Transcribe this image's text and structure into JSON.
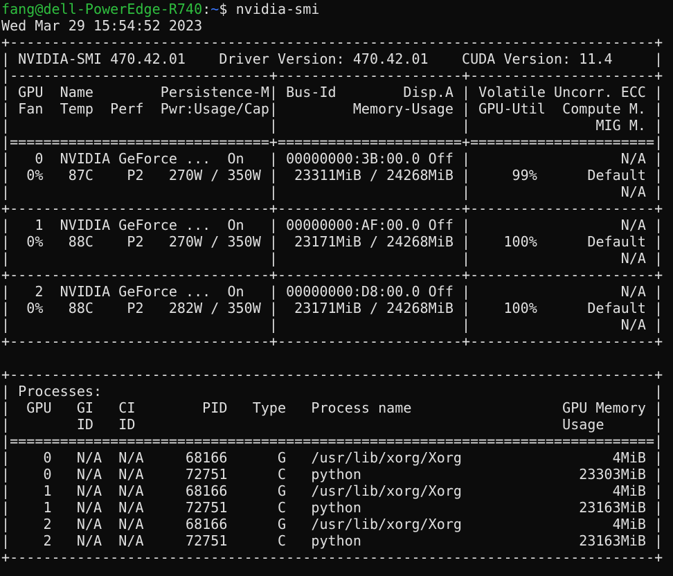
{
  "terminal": {
    "prompt": {
      "user_host": "fang@dell-PowerEdge-R740",
      "sep": ":",
      "path": "~",
      "symbol": "$ ",
      "command": "nvidia-smi"
    },
    "timestamp": "Wed Mar 29 15:54:52 2023",
    "colors": {
      "background": "#0c0c0c",
      "text": "#e0e0e0",
      "prompt_user": "#2fbf3f",
      "prompt_path": "#3b78ff"
    },
    "output_lines": [
      "+-----------------------------------------------------------------------------+",
      "| NVIDIA-SMI 470.42.01    Driver Version: 470.42.01    CUDA Version: 11.4     |",
      "|-------------------------------+----------------------+----------------------+",
      "| GPU  Name        Persistence-M| Bus-Id        Disp.A | Volatile Uncorr. ECC |",
      "| Fan  Temp  Perf  Pwr:Usage/Cap|         Memory-Usage | GPU-Util  Compute M. |",
      "|                               |                      |               MIG M. |",
      "|===============================+======================+======================|",
      "|   0  NVIDIA GeForce ...  On   | 00000000:3B:00.0 Off |                  N/A |",
      "|  0%   87C    P2   270W / 350W |  23311MiB / 24268MiB |     99%      Default |",
      "|                               |                      |                  N/A |",
      "+-------------------------------+----------------------+----------------------+",
      "|   1  NVIDIA GeForce ...  On   | 00000000:AF:00.0 Off |                  N/A |",
      "|  0%   88C    P2   270W / 350W |  23171MiB / 24268MiB |    100%      Default |",
      "|                               |                      |                  N/A |",
      "+-------------------------------+----------------------+----------------------+",
      "|   2  NVIDIA GeForce ...  On   | 00000000:D8:00.0 Off |                  N/A |",
      "|  0%   88C    P2   282W / 350W |  23171MiB / 24268MiB |    100%      Default |",
      "|                               |                      |                  N/A |",
      "+-------------------------------+----------------------+----------------------+",
      "",
      "+-----------------------------------------------------------------------------+",
      "| Processes:                                                                  |",
      "|  GPU   GI   CI        PID   Type   Process name                  GPU Memory |",
      "|        ID   ID                                                   Usage      |",
      "|=============================================================================|",
      "|    0   N/A  N/A     68166      G   /usr/lib/xorg/Xorg                  4MiB |",
      "|    0   N/A  N/A     72751      C   python                          23303MiB |",
      "|    1   N/A  N/A     68166      G   /usr/lib/xorg/Xorg                  4MiB |",
      "|    1   N/A  N/A     72751      C   python                          23163MiB |",
      "|    2   N/A  N/A     68166      G   /usr/lib/xorg/Xorg                  4MiB |",
      "|    2   N/A  N/A     72751      C   python                          23163MiB |",
      "+-----------------------------------------------------------------------------+"
    ]
  }
}
